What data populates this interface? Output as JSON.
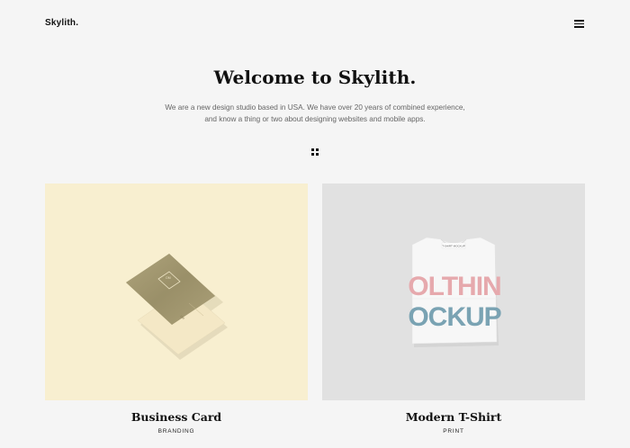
{
  "header": {
    "logo": "Skylith.",
    "menu_icon": "hamburger-menu-icon"
  },
  "hero": {
    "title": "Welcome to Skylith.",
    "line1": "We are a new design studio based in USA. We have over 20 years of combined experience,",
    "line2": "and know a thing or two about designing websites and mobile apps.",
    "filter_icon": "grid-filter-icon"
  },
  "portfolio": {
    "items": [
      {
        "title": "Business Card",
        "category": "BRANDING",
        "background": "#f8efd0",
        "card_text": "OM"
      },
      {
        "title": "Modern T-Shirt",
        "category": "PRINT",
        "background": "#e1e1e1",
        "tag_text": "T-SHIRT MOCKUP",
        "print_line1": "OLTHIN",
        "print_line2": "OCKUP"
      }
    ]
  }
}
